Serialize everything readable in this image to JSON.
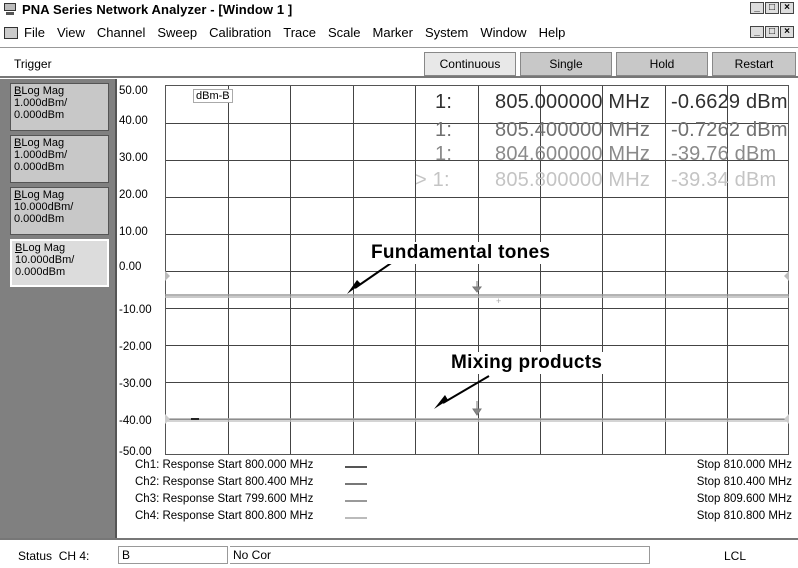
{
  "window": {
    "title": "PNA Series Network Analyzer - [Window 1 ]",
    "icon": "analyzer-icon"
  },
  "menu": {
    "items": [
      "File",
      "View",
      "Channel",
      "Sweep",
      "Calibration",
      "Trace",
      "Scale",
      "Marker",
      "System",
      "Window",
      "Help"
    ]
  },
  "toolbar": {
    "trigger_label": "Trigger",
    "continuous": "Continuous",
    "single": "Single",
    "hold": "Hold",
    "restart": "Restart"
  },
  "traces": [
    {
      "type": "Log Mag",
      "scale": "1.000dBm/",
      "ref": "0.000dBm"
    },
    {
      "type": "Log Mag",
      "scale": "1.000dBm/",
      "ref": "0.000dBm"
    },
    {
      "type": "Log Mag",
      "scale": "10.000dBm/",
      "ref": "0.000dBm"
    },
    {
      "type": "Log Mag",
      "scale": "10.000dBm/",
      "ref": "0.000dBm"
    }
  ],
  "plot": {
    "y_labels": [
      "50.00",
      "40.00",
      "30.00",
      "20.00",
      "10.00",
      "0.00",
      "-10.00",
      "-20.00",
      "-30.00",
      "-40.00",
      "-50.00"
    ],
    "trace_tag": "dBm-B",
    "markers": [
      {
        "id": "1:",
        "freq": "805.000000 MHz",
        "value": "-0.6629 dBm",
        "color": "#303030"
      },
      {
        "id": "1:",
        "freq": "805.400000 MHz",
        "value": "-0.7262 dBm",
        "color": "#707070"
      },
      {
        "id": "1:",
        "freq": "804.600000 MHz",
        "value": "-39.76 dBm",
        "color": "#8a8a8a"
      },
      {
        "id": "> 1:",
        "freq": "805.800000 MHz",
        "value": "-39.34 dBm",
        "color": "#c4c4c4"
      }
    ],
    "annotations": {
      "fundamental": "Fundamental tones",
      "mixing": "Mixing products"
    }
  },
  "channels": [
    {
      "start": "Ch1: Response Start  800.000 MHz",
      "stop": "Stop  810.000 MHz",
      "color": "#555555"
    },
    {
      "start": "Ch2: Response Start  800.400 MHz",
      "stop": "Stop  810.400 MHz",
      "color": "#777777"
    },
    {
      "start": "Ch3: Response Start  799.600 MHz",
      "stop": "Stop  809.600 MHz",
      "color": "#999999"
    },
    {
      "start": "Ch4: Response Start  800.800 MHz",
      "stop": "Stop  810.800 MHz",
      "color": "#bbbbbb"
    }
  ],
  "status": {
    "label": "Status",
    "channel": "CH 4:",
    "trace": "B",
    "correction": "No Cor",
    "lcl": "LCL"
  }
}
